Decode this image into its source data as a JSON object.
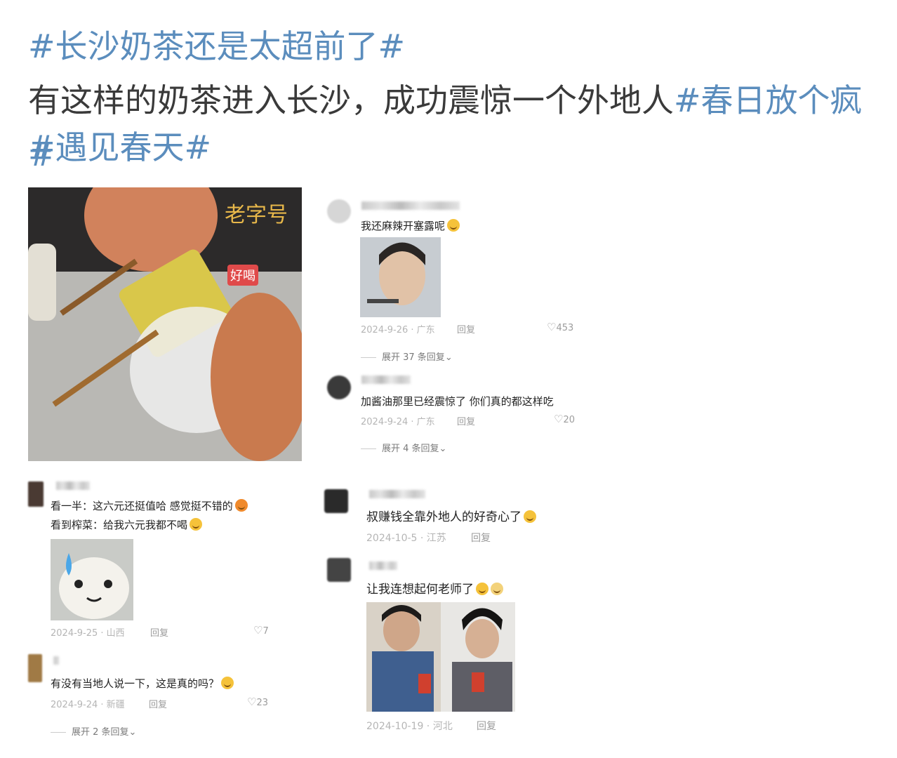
{
  "post": {
    "hashtag_main": "#长沙奶茶还是太超前了#",
    "text_line": "有这样的奶茶进入长沙，成功震惊一个外地人",
    "hashtag_spring": "#春日放个疯#",
    "hashtag_meet": "#遇见春天#"
  },
  "video": {
    "shop_sign": "老字号",
    "caption_sticker": "好喝"
  },
  "comments_right": [
    {
      "text": "我还麻辣开塞露呢",
      "date": "2024-9-26 · 广东",
      "reply": "回复",
      "likes": "453",
      "expand": "展开 37 条回复"
    },
    {
      "text": "加酱油那里已经震惊了 你们真的都这样吃",
      "date": "2024-9-24 · 广东",
      "reply": "回复",
      "likes": "20",
      "expand": "展开 4 条回复"
    },
    {
      "text": "叔赚钱全靠外地人的好奇心了",
      "date": "2024-10-5 · 江苏",
      "reply": "回复"
    },
    {
      "text": "让我连想起何老师了",
      "date": "2024-10-19 · 河北",
      "reply": "回复"
    }
  ],
  "comments_left": [
    {
      "text_line1": "看一半：这六元还挺值哈 感觉挺不错的",
      "text_line2": "看到榨菜：给我六元我都不喝",
      "date": "2024-9-25 · 山西",
      "reply": "回复",
      "likes": "7"
    },
    {
      "text": "有没有当地人说一下，这是真的吗？",
      "date": "2024-9-24 · 新疆",
      "reply": "回复",
      "likes": "23",
      "expand": "展开 2 条回复"
    }
  ]
}
